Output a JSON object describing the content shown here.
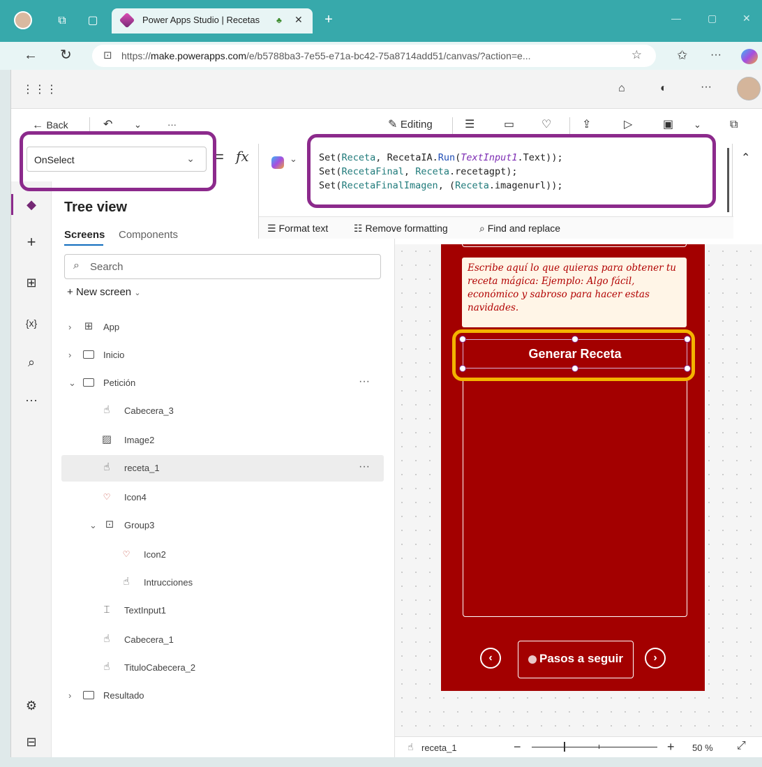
{
  "browser": {
    "tab_title": "Power Apps Studio | Recetas",
    "url_prefix": "https://",
    "url_domain": "make.powerapps.com",
    "url_rest": "/e/b5788ba3-7e55-e71a-bc42-75a8714add51/canvas/?action=e..."
  },
  "toolbar": {
    "back_label": "Back",
    "editing_label": "Editing"
  },
  "formula": {
    "property": "OnSelect",
    "lines": [
      {
        "p1": "Set(",
        "v1": "Receta",
        ", RecetaIA.": "",
        "fn": "Run",
        "p2": "(",
        "it": "TextInput1",
        ".Text));": ""
      }
    ],
    "line1": {
      "a": "Set(",
      "b": "Receta",
      ", ": ", ",
      "c": "RecetaIA",
      ".": ".",
      "d": "Run",
      "(": "(",
      "e": "TextInput1",
      "f": ".Text));"
    },
    "line2": {
      "a": "Set(",
      "b": "RecetaFinal",
      ", ": ", ",
      "c": "Receta",
      "f": ".recetagpt);"
    },
    "line3": {
      "a": "Set(",
      "b": "RecetaFinalImagen",
      ", (": ", (",
      "c": "Receta",
      "f": ".imagenurl));"
    },
    "format_text": "Format text",
    "remove_formatting": "Remove formatting",
    "find_replace": "Find and replace"
  },
  "tree": {
    "title": "Tree view",
    "tab_screens": "Screens",
    "tab_components": "Components",
    "search_placeholder": "Search",
    "new_screen": "New screen",
    "nodes": [
      "App",
      "Inicio",
      "Petición",
      "Cabecera_3",
      "Image2",
      "receta_1",
      "Icon4",
      "Group3",
      "Icon2",
      "Intrucciones",
      "TextInput1",
      "Cabecera_1",
      "TituloCabecera_2",
      "Resultado"
    ]
  },
  "canvas": {
    "prompt_text": "Escribe aquí lo que quieras para obtener tu receta mágica: Ejemplo: Algo fácil, económico y sabroso para hacer estas navidades.",
    "button_label": "Generar Receta",
    "steps_label": "Pasos a seguir",
    "prev_glyph": "‹",
    "next_glyph": "›"
  },
  "status": {
    "selected": "receta_1",
    "zoom": "50 %"
  },
  "colors": {
    "accent_app": "#a30000",
    "annotation_purple": "#8c2a8c",
    "annotation_gold": "#f4b300",
    "browser": "#37a9ab"
  }
}
